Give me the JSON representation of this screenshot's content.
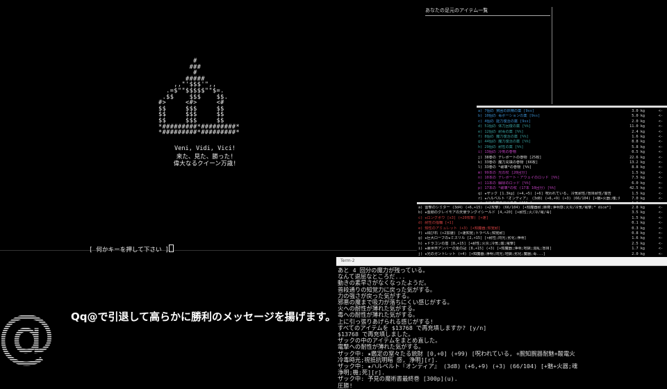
{
  "main": {
    "crown_art": "         #\n        ###\n         #\n       #####\n    ,,\"'$$$'\",,\n  .=$\"\"$$$$$\"\"$=.\n .$$    $$$    $$.\n#>     <#>     <#\n$$     $$$     $$\n$$     $$$     $$\n$$     $$$     $$\n*#########*#########*\n*#########*#########*",
    "veni": "Veni, Vidi, Vici!",
    "came_saw": "来た、見た、勝った!",
    "long_live": "偉大なるクイーン万歳!",
    "press_key": "[ 何かキーを押して下さい ]"
  },
  "inventory": {
    "title": "あなたの足元のアイテム一覧"
  },
  "window_a": {
    "rows": [
      {
        "text": "a) 7個の 貧困の妖精の薬 [9ss]",
        "weight": "3.0 kg",
        "arrow": "<-",
        "color": "#3a8fd0"
      },
      {
        "text": "b) 10個の 毒ポーションの薬 [9ss]",
        "weight": "5.0 kg",
        "arrow": "<-",
        "color": "#3a8fd0"
      },
      {
        "text": "c) 4個の 能力復活の薬 [9ss]",
        "weight": "2.0 kg",
        "arrow": "<-",
        "color": "#3a8fd0"
      },
      {
        "text": "d) 51個の 体力回復の薬 [%%]",
        "weight": "11.0 kg",
        "arrow": "<-",
        "color": "#3aa0a0"
      },
      {
        "text": "e) 12個の 耐毒の薬 [%%]",
        "weight": "2.4 kg",
        "arrow": "<-",
        "color": "#3aa0a0"
      },
      {
        "text": "f) 8個の 魔力復活の薬 [%%]",
        "weight": "1.6 kg",
        "arrow": "<-",
        "color": "#3aa0a0"
      },
      {
        "text": "g) 44個の 魔力復活の薬 [%%]",
        "weight": "8.8 kg",
        "arrow": "<-",
        "color": "#3aa0a0"
      },
      {
        "text": "h) 29個の 耐性の薬 [%%]",
        "weight": "5.8 kg",
        "arrow": "<-",
        "color": "#3aa0a0"
      },
      {
        "text": "i) 13個の 冷気の巻物",
        "weight": "0.5 kg",
        "arrow": "<-",
        "color": "#c040c0"
      },
      {
        "text": "j) 38巻の テレポートの巻物 [25枚]",
        "weight": "22.6 kg",
        "arrow": "<-",
        "color": "#ddd"
      },
      {
        "text": "k) 33巻の 魔力充填の巻物 [66枚]",
        "weight": "13.2 kg",
        "arrow": "<-",
        "color": "#ddd"
      },
      {
        "text": "l) 33巻の *破壊*の巻物 [%%]",
        "weight": "8.8 kg",
        "arrow": "<-",
        "color": "#ddd"
      },
      {
        "text": "m) 99本の 光の杖 [20回分]",
        "weight": "1.5 kg",
        "arrow": "<-",
        "color": "#c040c0"
      },
      {
        "text": "n) 10本の テレポート・アウェイのロッド [%%]",
        "weight": "7.5 kg",
        "arrow": "<-",
        "color": "#c040c0"
      },
      {
        "text": "o) 11本の 解除のロッド [%%]",
        "weight": "6.0 kg",
        "arrow": "<-",
        "color": "#c040c0"
      },
      {
        "text": "p) 17本の *破壊*の杖 (17本 10回分) [%%]",
        "weight": "42.5 kg",
        "arrow": "<-",
        "color": "#c040c0"
      },
      {
        "text": "q) ★ザック [1.3kg] (+4,+5) [+6] 呪われている, 冷気耐性/盲目耐性/警告",
        "weight": "1.5 kg",
        "arrow": "<-",
        "color": "#ddd"
      },
      {
        "text": "r) ★ハルベルト『オンディア』 (3d8) (+6,+9) (+3) (66/104) [+魅+火器;魂;浄明;機]",
        "weight": "7.0 kg",
        "arrow": "<-",
        "color": "#ddd"
      },
      {
        "text": "s) 予見の魔術書最終巻 [300p]",
        "weight": "1.0 kg",
        "arrow": "<-",
        "color": "#ddd"
      }
    ]
  },
  "window_b": {
    "rows": [
      {
        "text": "a) 雷撃のシミター (3d4) (+6,+15) (+2攻撃) (66/104) [+知魔器耐;麻痺;浄明感;火炎/冷気/電撃;* dice*]",
        "weight": "2.8 kg",
        "arrow": "<-",
        "color": "#ddd"
      },
      {
        "text": "b) ★金剛のクレイモアの天使ラングイシールド [4,+20] [+耐性;火/冷/電/毒]",
        "weight": "3.5 kg",
        "arrow": "<-",
        "color": "#ddd"
      },
      {
        "text": "c) ★ロングボウ [x3] (+20攻撃) [+速]",
        "weight": "1.5 kg",
        "arrow": "<-",
        "color": "#d04040"
      },
      {
        "text": "d) 耐性の指輪 [+1]",
        "weight": "0.1 kg",
        "arrow": "<-",
        "color": "#d04040"
      },
      {
        "text": "e) 知性のアミュレット (+3) [+知魔器;知覚耐]",
        "weight": "0.3 kg",
        "arrow": "<-",
        "color": "#d04040"
      },
      {
        "text": "f) ★飛び石 (+2加速) [+速知覚;トラベル;知覚耐]",
        "weight": "0.8 kg",
        "arrow": "<-",
        "color": "#ddd"
      },
      {
        "text": "g) ★巨大ローブの★ミスリル [2,+15] [+耐性;閃光;劣化;浄明]",
        "weight": "1.6 kg",
        "arrow": "<-",
        "color": "#ddd"
      },
      {
        "text": "h) ★ドラゴンの盾 [8,+15] [+耐性;火炎;冷気;酸;電撃]",
        "weight": "2.5 kg",
        "arrow": "<-",
        "color": "#ddd"
      },
      {
        "text": "i) ★裏世界アンバーの金の冠 [8,+15] (+3) [+知魔器;浄明;地獄;混乱;盲目]",
        "weight": "1.7 kg",
        "arrow": "<-",
        "color": "#ddd"
      },
      {
        "text": "j) ★光のガントレット (+4) [+知魔器;浄明;閃光;地獄;劣化;魔器;毒...]",
        "weight": "2.0 kg",
        "arrow": "<-",
        "color": "#ddd"
      },
      {
        "text": "k) 精天界の鉄頭靴の靴 [6,+18] (+3) [+速知覚;浄明]",
        "weight": "1.6 kg",
        "arrow": "<-",
        "color": "#ddd"
      }
    ]
  },
  "term2": {
    "title": "Term-2",
    "lines": [
      "あと 4 回分の魔力が残っている。",
      "なんて退屈なところだ...",
      "動きの素早さがなくなったようだ。",
      "普段通りの知覚力に戻った気がする。",
      "力の強さが戻った気がする。",
      "邪悪の魔まで吸力が落ちにくい感じがする。",
      "火への耐性が薄れた気がする。",
      "毒への耐性が薄れた気がする。",
      "上に引っ張りあげられる感じがする!",
      "すべてのアイテムを $13768 で再充填しますか? [y/n]",
      "$13768 で再充填しました。",
      "ザックの中のアイテムをまとめ直した。",
      "電撃への耐性が薄れた気がする。",
      "ザック中: ★鑑定の窒々たる銃財 [0,+0] (+99) [呪われている, +腕知腕器耐魅+酸電火",
      "冷毒時光;視抵抗明暗 感, 浄明][r].",
      "ザック中: ★ハルベルト『オンディア』 (3d8) (+6,+9) (+3) (66/104) [+魅+火器;魂",
      "浄明;機;死][r].",
      "ザック中: 予見の魔術書最終巻 [300p](u).",
      "圧勝!"
    ]
  },
  "overlay": {
    "logo_icon": "at-sign-icon",
    "caption": "Qq@で引退して高らかに勝利のメッセージを揚げます。"
  }
}
